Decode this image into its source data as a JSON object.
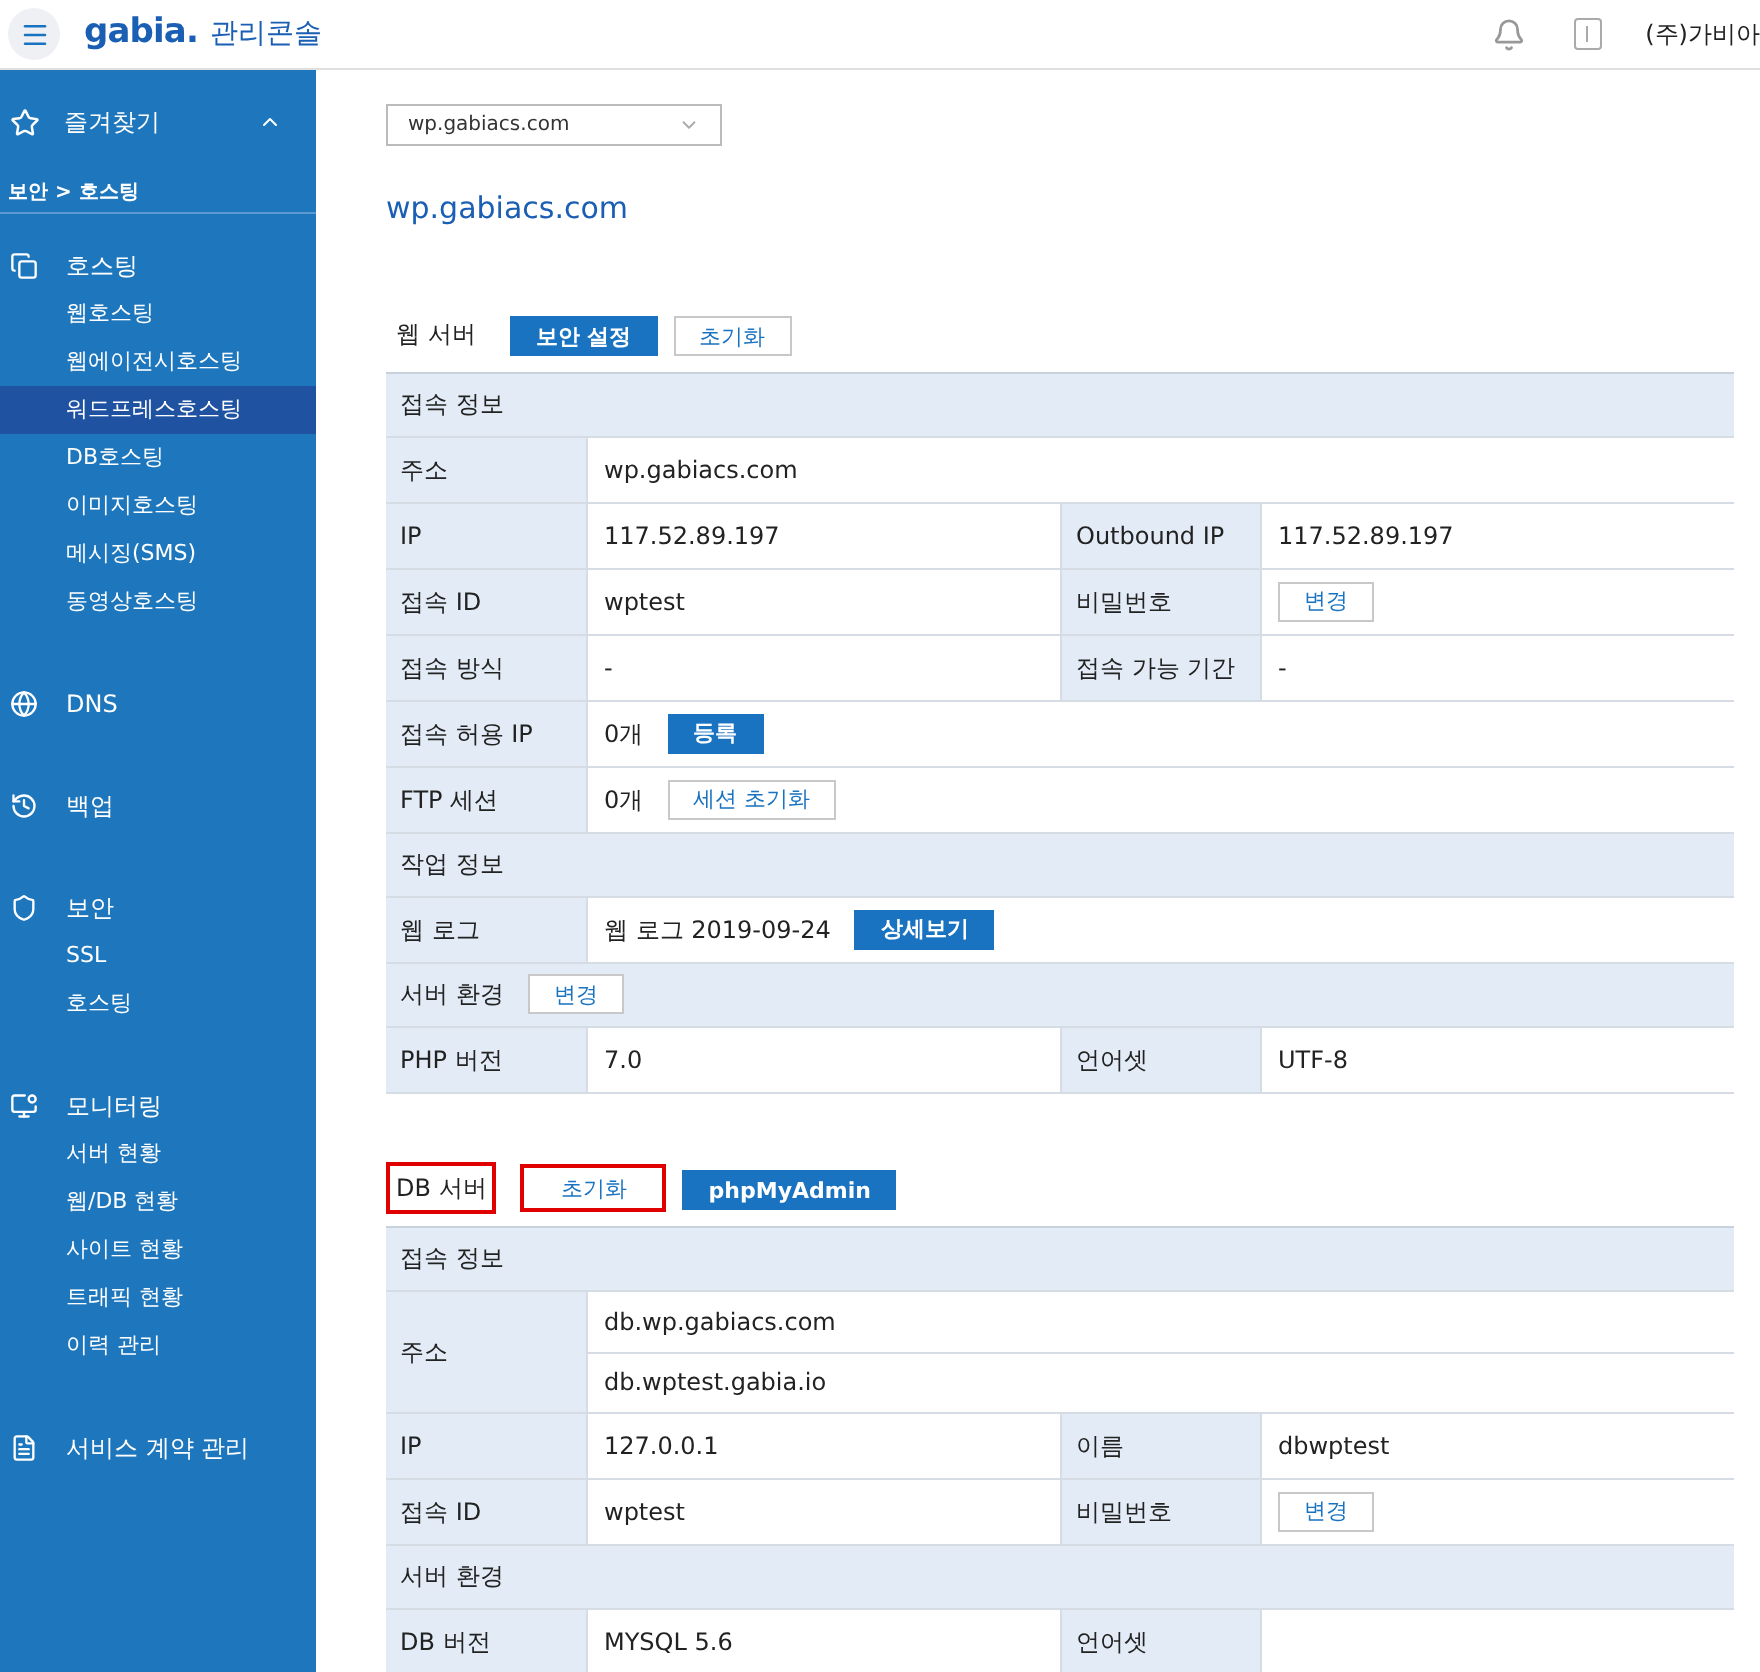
{
  "header": {
    "logo": "gabia.",
    "title": "관리콘솔",
    "company": "(주)가비아"
  },
  "sidebar": {
    "favorites": {
      "label": "즐겨찾기",
      "expanded": true
    },
    "breadcrumb": "보안 > 호스팅",
    "groups": [
      {
        "label": "호스팅",
        "children": [
          {
            "label": "웹호스팅",
            "selected": false
          },
          {
            "label": "웹에이전시호스팅",
            "selected": false
          },
          {
            "label": "워드프레스호스팅",
            "selected": true
          },
          {
            "label": "DB호스팅",
            "selected": false
          },
          {
            "label": "이미지호스팅",
            "selected": false
          },
          {
            "label": "메시징(SMS)",
            "selected": false
          },
          {
            "label": "동영상호스팅",
            "selected": false
          }
        ]
      },
      {
        "label": "DNS"
      },
      {
        "label": "백업"
      },
      {
        "label": "보안",
        "children": [
          {
            "label": "SSL",
            "selected": false
          },
          {
            "label": "호스팅",
            "selected": false
          }
        ]
      },
      {
        "label": "모니터링",
        "children": [
          {
            "label": "서버 현황",
            "selected": false
          },
          {
            "label": "웹/DB 현황",
            "selected": false
          },
          {
            "label": "사이트 현황",
            "selected": false
          },
          {
            "label": "트래픽 현황",
            "selected": false
          },
          {
            "label": "이력 관리",
            "selected": false
          }
        ]
      },
      {
        "label": "서비스 계약 관리"
      }
    ]
  },
  "domain_select": {
    "value": "wp.gabiacs.com"
  },
  "page_title": "wp.gabiacs.com",
  "sections": [
    {
      "title": "웹 서버",
      "highlighted": false,
      "buttons": [
        {
          "label": "보안 설정",
          "kind": "primary",
          "highlighted": false
        },
        {
          "label": "초기화",
          "kind": "secondary",
          "highlighted": false
        }
      ],
      "rows": [
        {
          "kind": "section",
          "label": "접속 정보"
        },
        {
          "kind": "field",
          "cells": [
            {
              "label": "주소",
              "values": [
                "wp.gabiacs.com"
              ]
            }
          ]
        },
        {
          "kind": "field",
          "cells": [
            {
              "label": "IP",
              "values": [
                "117.52.89.197"
              ]
            },
            {
              "label": "Outbound IP",
              "values": [
                "117.52.89.197"
              ]
            }
          ]
        },
        {
          "kind": "field",
          "cells": [
            {
              "label": "접속 ID",
              "values": [
                "wptest"
              ]
            },
            {
              "label": "비밀번호",
              "action": {
                "label": "변경",
                "kind": "secondary"
              }
            }
          ]
        },
        {
          "kind": "field",
          "cells": [
            {
              "label": "접속 방식",
              "values": [
                "-"
              ]
            },
            {
              "label": "접속 가능 기간",
              "values": [
                "-"
              ]
            }
          ]
        },
        {
          "kind": "field",
          "cells": [
            {
              "label": "접속 허용 IP",
              "values": [
                "0개"
              ],
              "action": {
                "label": "등록",
                "kind": "primary"
              }
            }
          ]
        },
        {
          "kind": "field",
          "cells": [
            {
              "label": "FTP 세션",
              "values": [
                "0개"
              ],
              "action": {
                "label": "세션 초기화",
                "kind": "secondary"
              }
            }
          ]
        },
        {
          "kind": "section",
          "label": "작업 정보"
        },
        {
          "kind": "field",
          "cells": [
            {
              "label": "웹 로그",
              "values": [
                "웹 로그 2019-09-24"
              ],
              "action": {
                "label": "상세보기",
                "kind": "primary"
              }
            }
          ]
        },
        {
          "kind": "section",
          "label": "서버 환경",
          "action": {
            "label": "변경",
            "kind": "secondary"
          }
        },
        {
          "kind": "field",
          "cells": [
            {
              "label": "PHP 버전",
              "values": [
                "7.0"
              ]
            },
            {
              "label": "언어셋",
              "values": [
                "UTF-8"
              ]
            }
          ]
        }
      ]
    },
    {
      "title": "DB 서버",
      "highlighted": true,
      "buttons": [
        {
          "label": "초기화",
          "kind": "secondary",
          "highlighted": true
        },
        {
          "label": "phpMyAdmin",
          "kind": "primary",
          "highlighted": false
        }
      ],
      "rows": [
        {
          "kind": "section",
          "label": "접속 정보"
        },
        {
          "kind": "field",
          "cells": [
            {
              "label": "주소",
              "values": [
                "db.wp.gabiacs.com",
                "db.wptest.gabia.io"
              ]
            }
          ]
        },
        {
          "kind": "field",
          "cells": [
            {
              "label": "IP",
              "values": [
                "127.0.0.1"
              ]
            },
            {
              "label": "이름",
              "values": [
                "dbwptest"
              ]
            }
          ]
        },
        {
          "kind": "field",
          "cells": [
            {
              "label": "접속 ID",
              "values": [
                "wptest"
              ]
            },
            {
              "label": "비밀번호",
              "action": {
                "label": "변경",
                "kind": "secondary"
              }
            }
          ]
        },
        {
          "kind": "section",
          "label": "서버 환경"
        },
        {
          "kind": "field",
          "cells": [
            {
              "label": "DB 버전",
              "values": [
                "MYSQL 5.6"
              ]
            },
            {
              "label": "언어셋"
            }
          ]
        }
      ]
    }
  ]
}
